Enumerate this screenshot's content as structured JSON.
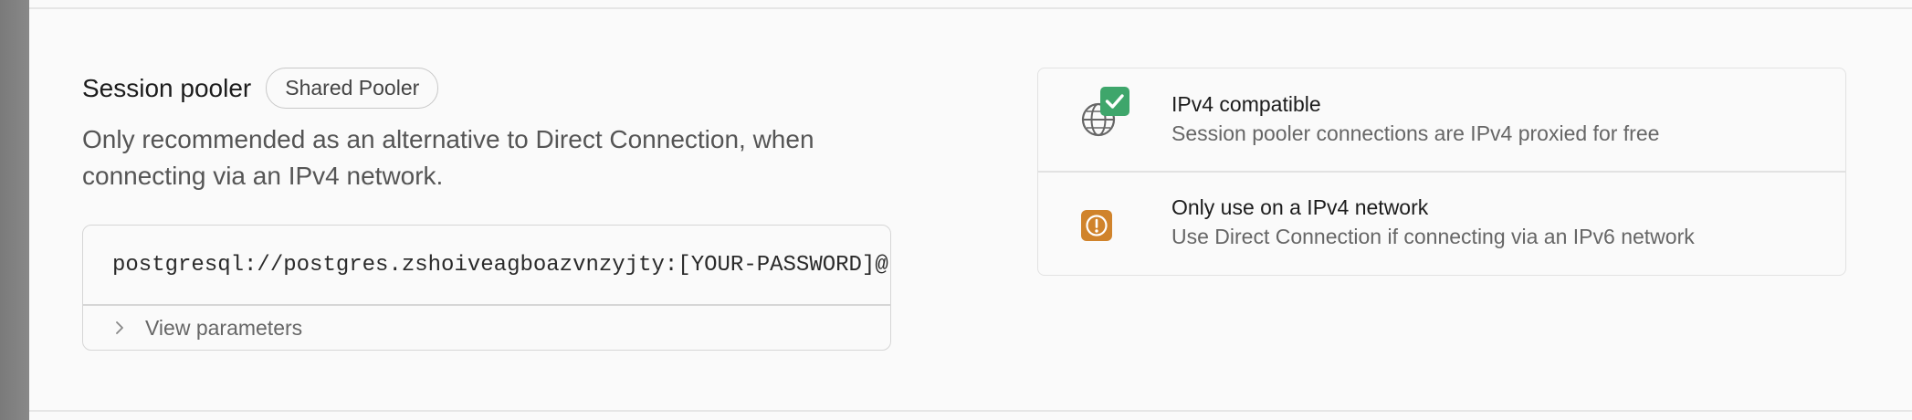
{
  "session_pooler": {
    "title": "Session pooler",
    "badge": "Shared Pooler",
    "description": "Only recommended as an alternative to Direct Connection, when connecting via an IPv4 network.",
    "connection_string": "postgresql://postgres.zshoiveagboazvnzyjty:[YOUR-PASSWORD]@",
    "view_parameters_label": "View parameters"
  },
  "info_card": {
    "rows": [
      {
        "title": "IPv4 compatible",
        "subtitle": "Session pooler connections are IPv4 proxied for free",
        "icon": "globe-check-icon",
        "accent": "#3ea66b"
      },
      {
        "title": "Only use on a IPv4 network",
        "subtitle": "Use Direct Connection if connecting via an IPv6 network",
        "icon": "warning-icon",
        "accent": "#d0832b"
      }
    ]
  }
}
